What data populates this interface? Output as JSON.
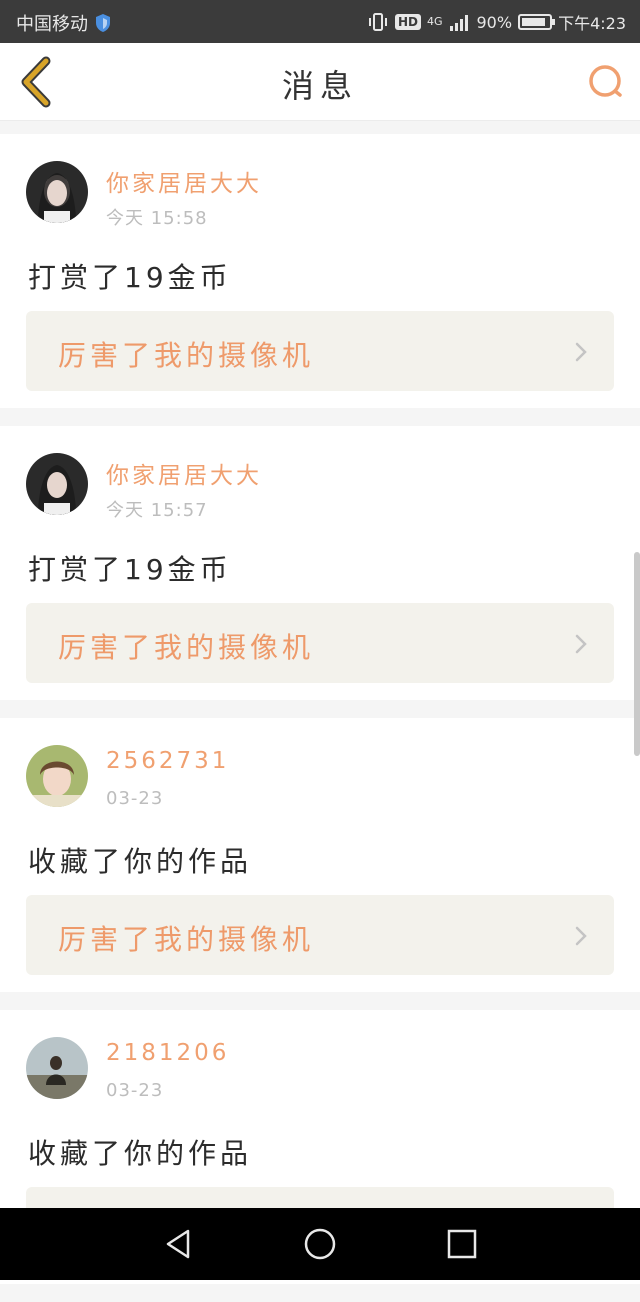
{
  "status_bar": {
    "carrier": "中国移动",
    "network": "4G",
    "battery": "90%",
    "time": "下午4:23",
    "battery_level": 0.9
  },
  "header": {
    "title": "消息",
    "back_icon": "chevron-left-icon",
    "search_icon": "search-icon"
  },
  "colors": {
    "accent": "#f0a070",
    "work_bg": "#f3f2ec",
    "back_icon": "#d4a020"
  },
  "messages": [
    {
      "name": "你家居居大大",
      "time": "今天 15:58",
      "action": "打赏了19金币",
      "work_title": "厉害了我的摄像机"
    },
    {
      "name": "你家居居大大",
      "time": "今天 15:57",
      "action": "打赏了19金币",
      "work_title": "厉害了我的摄像机"
    },
    {
      "name": "2562731",
      "time": "03-23",
      "action": "收藏了你的作品",
      "work_title": "厉害了我的摄像机"
    },
    {
      "name": "2181206",
      "time": "03-23",
      "action": "收藏了你的作品",
      "work_title": ""
    }
  ],
  "nav_bar": {
    "back": "triangle-back-icon",
    "home": "circle-home-icon",
    "recent": "square-recent-icon"
  }
}
